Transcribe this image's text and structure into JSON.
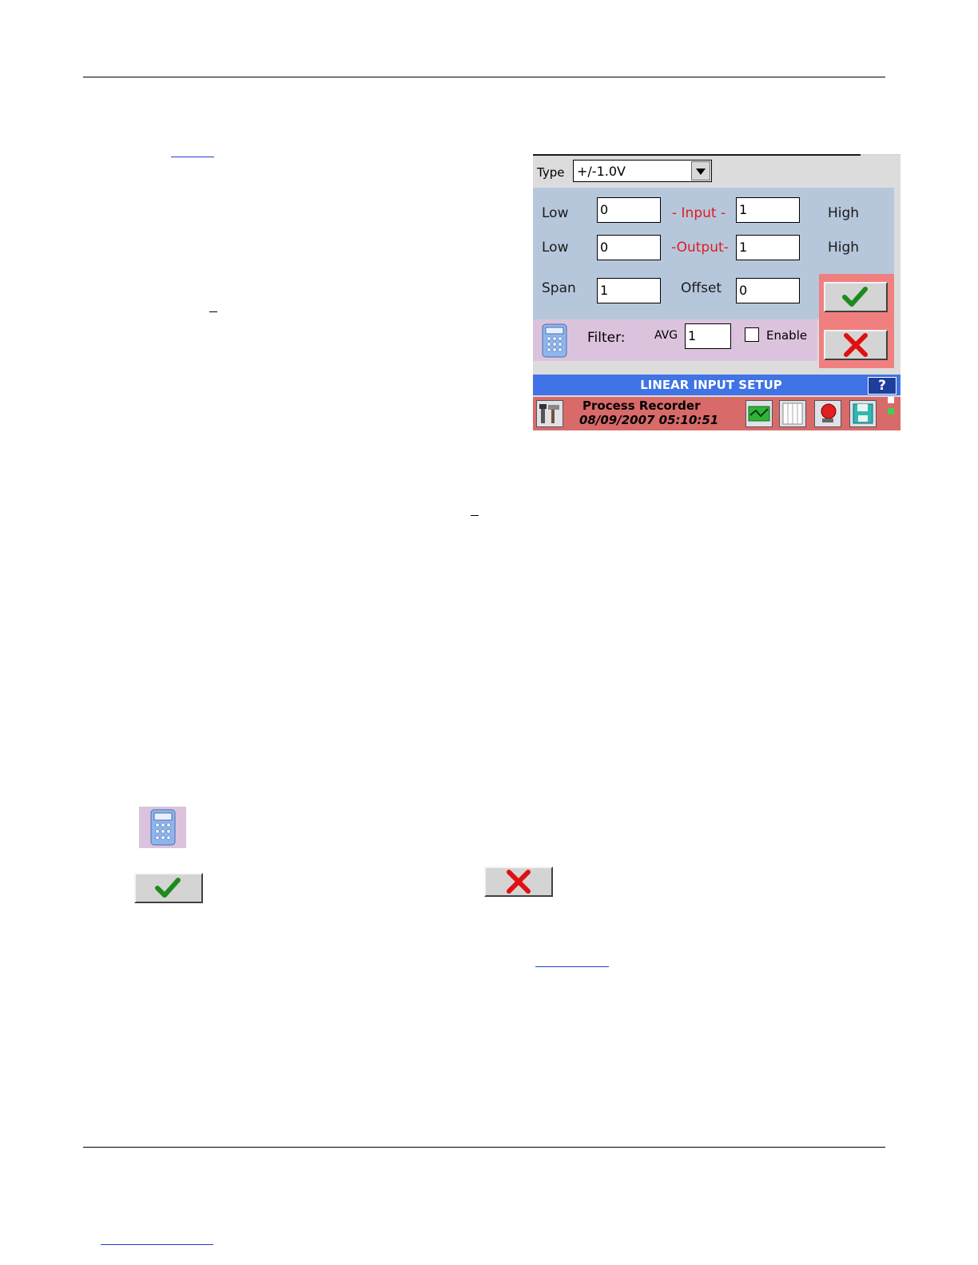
{
  "panel": {
    "type_label": "Type",
    "type_value": "+/-1.0V",
    "rows": {
      "input": {
        "low_label": "Low",
        "center_label": "- Input -",
        "high_label": "High",
        "low_value": "0",
        "high_value": "1"
      },
      "output": {
        "low_label": "Low",
        "center_label": "-Output-",
        "high_label": "High",
        "low_value": "0",
        "high_value": "1"
      },
      "span": {
        "span_label": "Span",
        "span_value": "1",
        "offset_label": "Offset",
        "offset_value": "0"
      }
    },
    "filter": {
      "filter_label": "Filter:",
      "avg_label": "AVG",
      "avg_value": "1",
      "enable_label": "Enable",
      "enabled": false
    },
    "title_bar": {
      "title": "LINEAR INPUT SETUP",
      "help_label": "?"
    },
    "status_bar": {
      "name": "Process Recorder",
      "datetime": "08/09/2007 05:10:51"
    }
  },
  "icons": {
    "calculator": "calculator-icon",
    "ok": "checkmark-icon",
    "cancel": "x-icon",
    "tools": "tools-icon",
    "graph": "graph-icon",
    "table": "table-icon",
    "alarm": "alarm-icon",
    "save": "save-icon"
  },
  "colors": {
    "blue_area": "#b6c7dc",
    "pink_area": "#dcc3dd",
    "red_area": "#f08080",
    "title_bar": "#3f73e6",
    "status_bar": "#d86a6a",
    "red_label": "#e21b1b"
  }
}
